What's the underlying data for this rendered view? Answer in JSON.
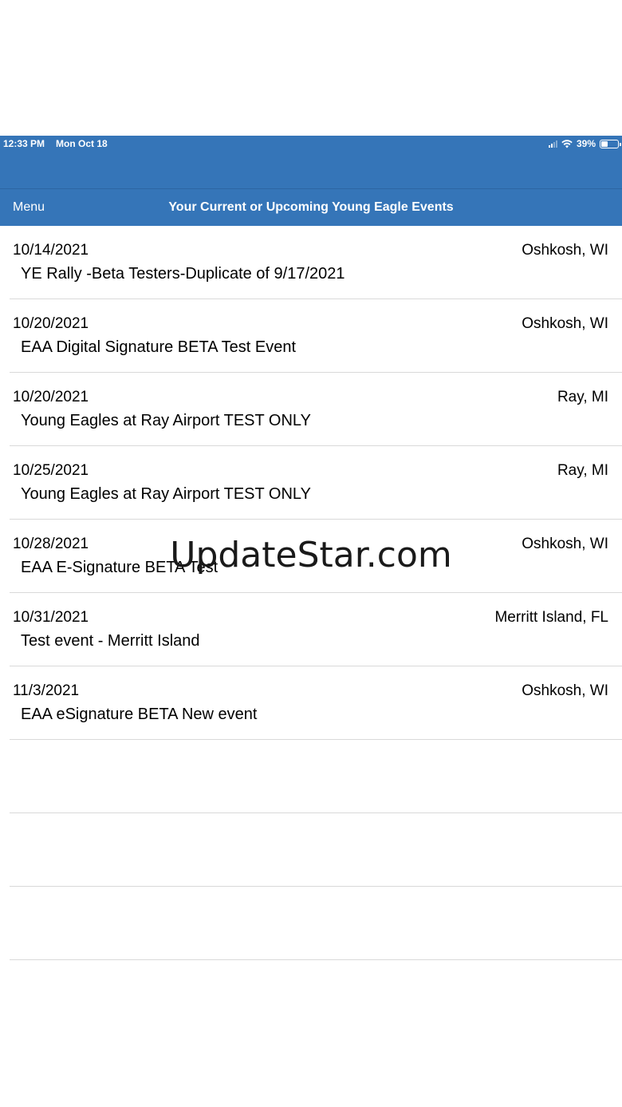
{
  "status_bar": {
    "time": "12:33 PM",
    "date": "Mon Oct 18",
    "battery_percent": "39%",
    "battery_level": 0.39,
    "icons": [
      "signal-icon",
      "wifi-icon",
      "battery-icon"
    ]
  },
  "nav": {
    "menu_label": "Menu",
    "title": "Your Current or Upcoming Young Eagle Events"
  },
  "events": [
    {
      "date": "10/14/2021",
      "location": "Oshkosh,  WI",
      "name": "YE Rally -Beta Testers-Duplicate of 9/17/2021"
    },
    {
      "date": "10/20/2021",
      "location": "Oshkosh,  WI",
      "name": "EAA Digital Signature BETA Test Event"
    },
    {
      "date": "10/20/2021",
      "location": "Ray,  MI",
      "name": "Young Eagles at Ray Airport TEST ONLY"
    },
    {
      "date": "10/25/2021",
      "location": "Ray,  MI",
      "name": "Young Eagles at Ray Airport TEST ONLY"
    },
    {
      "date": "10/28/2021",
      "location": "Oshkosh,  WI",
      "name": "EAA E-Signature BETA Test"
    },
    {
      "date": "10/31/2021",
      "location": "Merritt Island,  FL",
      "name": "Test event - Merritt Island"
    },
    {
      "date": "11/3/2021",
      "location": "Oshkosh,  WI",
      "name": "EAA eSignature BETA New event"
    }
  ],
  "watermark": "UpdateStar.com",
  "colors": {
    "header_blue": "#3575b8",
    "separator": "#d9d9d9"
  }
}
